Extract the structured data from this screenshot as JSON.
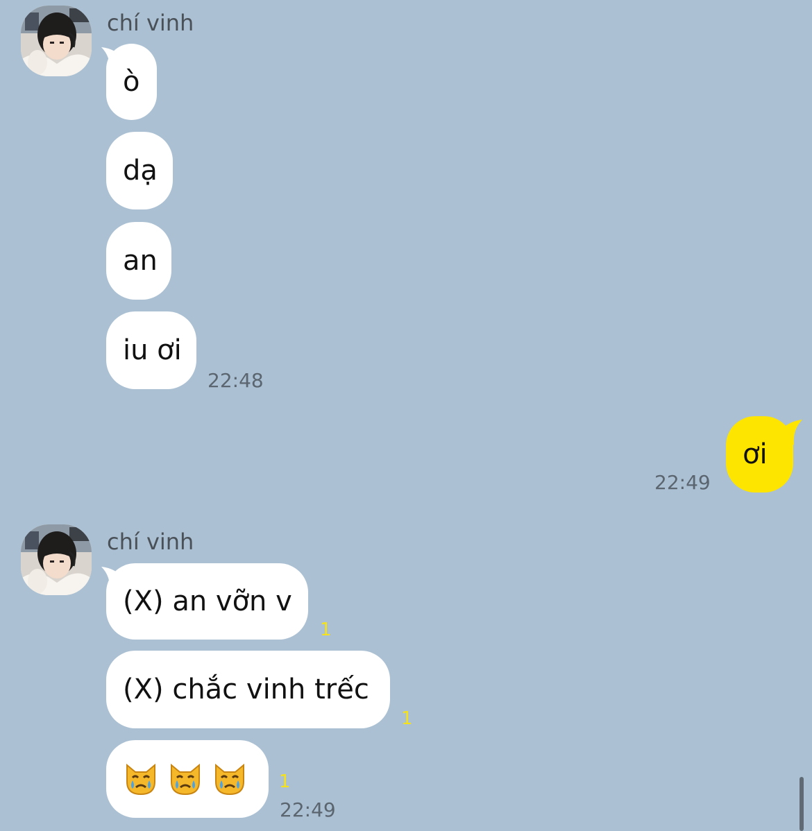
{
  "chat": {
    "groups": [
      {
        "sender": "chí vinh",
        "messages": [
          "ò",
          "dạ",
          "an",
          "iu ơi"
        ],
        "time": "22:48"
      },
      {
        "sender": "me",
        "messages": [
          "ơi"
        ],
        "time": "22:49"
      },
      {
        "sender": "chí vinh",
        "messages": [
          "(X) an vỡn v",
          "(X) chắc vinh trếc",
          "😿😿😿"
        ],
        "unread_counts": [
          "1",
          "1",
          "1"
        ],
        "time": "22:49"
      }
    ]
  },
  "icons": {
    "avatar": "profile-photo-avatar",
    "emoji": "crying-cat-face-emoji"
  },
  "colors": {
    "background": "#abc1d3",
    "incoming_bubble": "#ffffff",
    "outgoing_bubble": "#fee500",
    "unread": "#f5e21a"
  }
}
